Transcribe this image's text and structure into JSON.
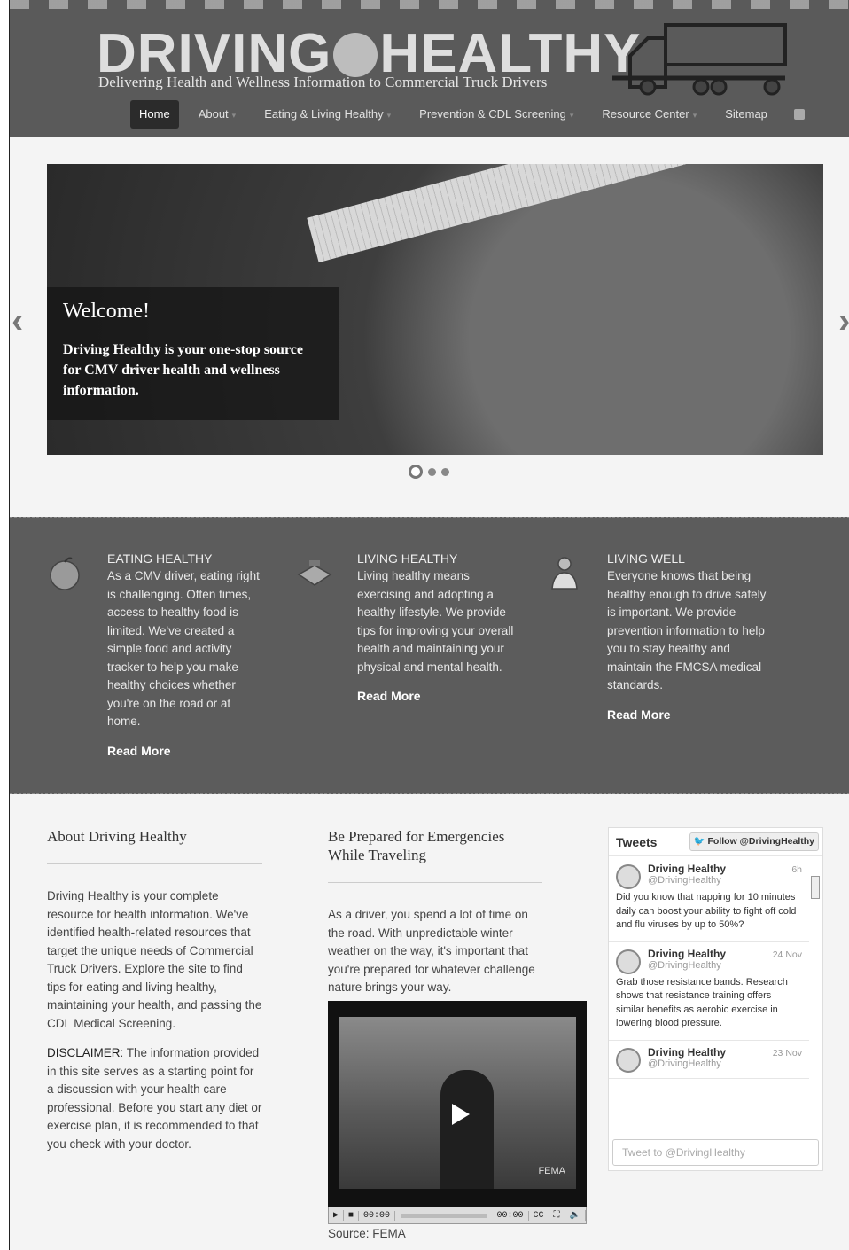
{
  "header": {
    "logo_text_left": "DRIVING",
    "logo_text_right": "HEALTHY",
    "tagline": "Delivering Health and Wellness Information to Commercial Truck Drivers"
  },
  "nav": {
    "items": [
      {
        "label": "Home",
        "active": true
      },
      {
        "label": "About"
      },
      {
        "label": "Eating & Living Healthy"
      },
      {
        "label": "Prevention & CDL Screening"
      },
      {
        "label": "Resource Center"
      },
      {
        "label": "Sitemap"
      }
    ],
    "rss_icon": "rss-icon"
  },
  "slider": {
    "title": "Welcome!",
    "text": "Driving Healthy is your one-stop source for CMV driver health and wellness information.",
    "prev_icon": "chevron-left-icon",
    "next_icon": "chevron-right-icon",
    "slide_count": 3,
    "active_slide": 1
  },
  "features": [
    {
      "icon": "apple-icon",
      "title": "EATING HEALTHY",
      "text": "As a CMV driver, eating right is challenging. Often times, access to healthy food is limited. We've created a simple food and activity tracker to help you make healthy choices whether you're on the road or at home.",
      "link": "Read More"
    },
    {
      "icon": "scale-icon",
      "title": "LIVING HEALTHY",
      "text": "Living healthy means exercising and adopting a healthy lifestyle. We provide tips for improving your overall health and maintaining your physical and mental health.",
      "link": "Read More"
    },
    {
      "icon": "doctor-icon",
      "title": "LIVING WELL",
      "text": "Everyone knows that being healthy enough to drive safely is important. We provide prevention information to help you to stay healthy and maintain the FMCSA medical standards.",
      "link": "Read More"
    }
  ],
  "about": {
    "title": "About Driving Healthy",
    "text": "Driving Healthy is your complete resource for health information. We've identified health-related resources that target the unique needs of Commercial Truck Drivers. Explore the site to find tips for eating and living healthy, maintaining your health, and passing the CDL Medical Screening.",
    "disclaimer_label": "DISCLAIMER",
    "disclaimer_text": ": The information provided in this site serves as a starting point for a discussion with your health care professional. Before you start any diet or exercise plan, it is recommended to that you check with your doctor."
  },
  "emergencies": {
    "title": "Be Prepared for Emergencies While Traveling",
    "text": "As a driver, you spend a lot of time on the road. With unpredictable winter weather on the way, it's important that you're prepared for whatever challenge nature brings your way.",
    "video_watermark": "FEMA",
    "time_current": "00:00",
    "time_total": "00:00",
    "cc_label": "CC",
    "source": "Source: FEMA"
  },
  "tweets": {
    "title": "Tweets",
    "follow_label": "Follow @DrivingHealthy",
    "input_placeholder": "Tweet to @DrivingHealthy",
    "items": [
      {
        "name": "Driving Healthy",
        "handle": "@DrivingHealthy",
        "time": "6h",
        "text": "Did you know that napping for 10 minutes daily can boost your ability to fight off cold and flu viruses by up to 50%?"
      },
      {
        "name": "Driving Healthy",
        "handle": "@DrivingHealthy",
        "time": "24 Nov",
        "text": "Grab those resistance bands. Research shows that resistance training offers similar benefits as aerobic exercise in lowering blood pressure."
      },
      {
        "name": "Driving Healthy",
        "handle": "@DrivingHealthy",
        "time": "23 Nov",
        "text": ""
      }
    ]
  }
}
